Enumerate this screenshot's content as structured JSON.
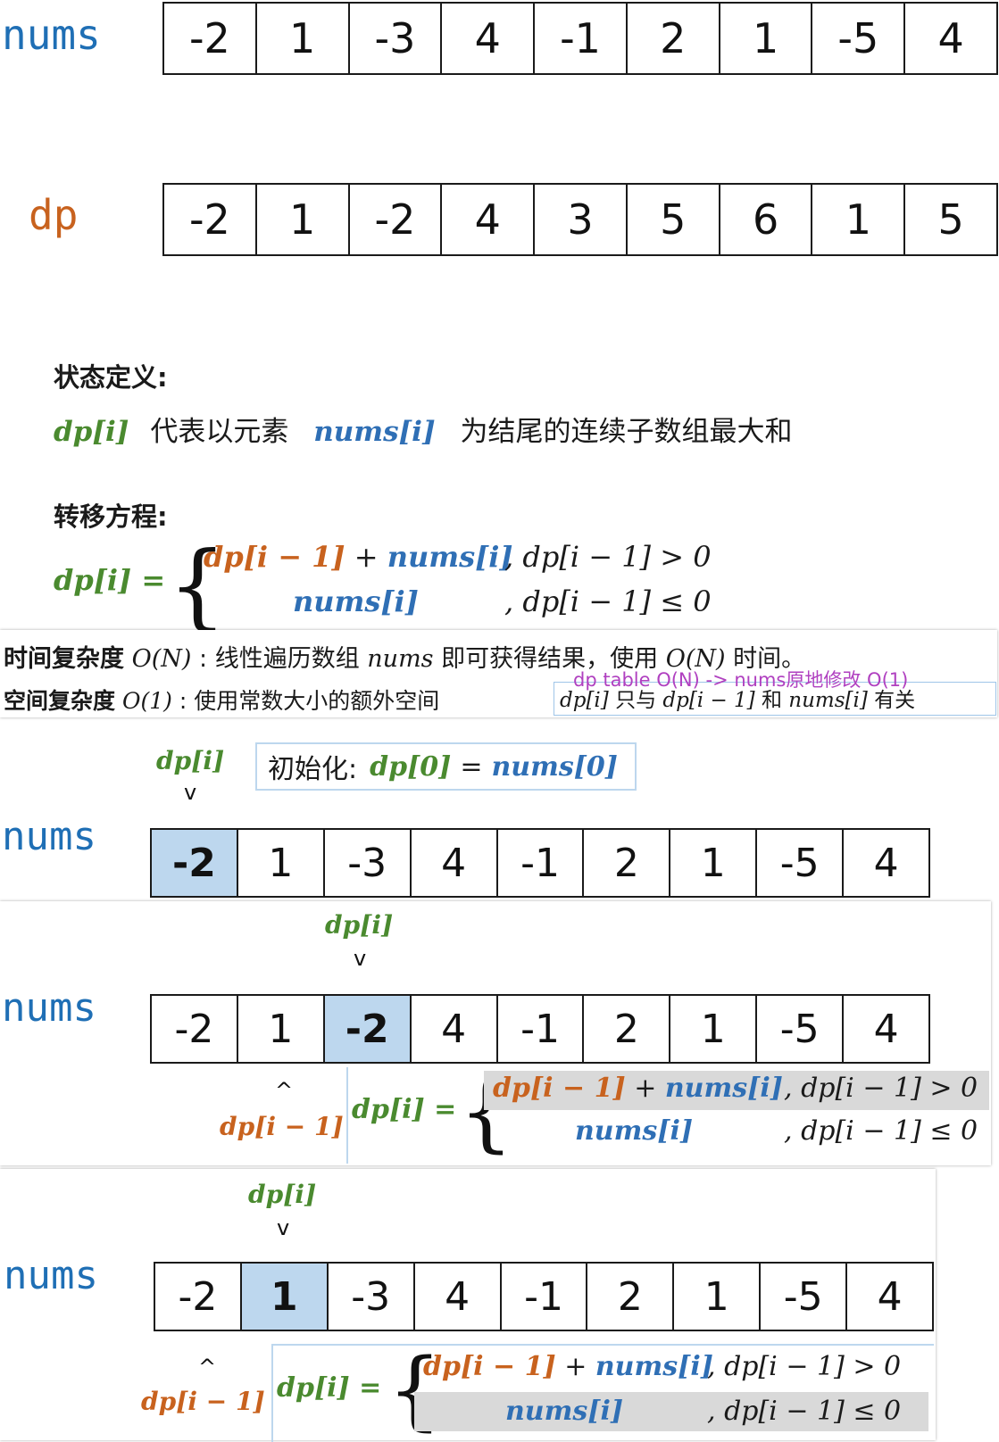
{
  "arrays": {
    "nums_label": "nums",
    "dp_label": "dp",
    "nums": [
      "-2",
      "1",
      "-3",
      "4",
      "-1",
      "2",
      "1",
      "-5",
      "4"
    ],
    "dp": [
      "-2",
      "1",
      "-2",
      "4",
      "3",
      "5",
      "6",
      "1",
      "5"
    ]
  },
  "definition": {
    "state_title": "状态定义:",
    "dp_i": "dp[i]",
    "text_represent": "代表以元素",
    "nums_i": "nums[i]",
    "text_rest": "为结尾的连续子数组最大和",
    "transfer_title": "转移方程:",
    "eq_lhs": "dp[i] =",
    "case1_expr_a": "dp[i − 1]",
    "plus": "+",
    "case1_expr_b": "nums[i]",
    "case1_cond": ", dp[i − 1] > 0",
    "case2_expr": "nums[i]",
    "case2_cond": ", dp[i − 1] ≤ 0"
  },
  "complexity": {
    "time_label": "时间复杂度",
    "time_on": "O(N)",
    "time_text_a": ": 线性遍历数组",
    "time_nums": "nums",
    "time_text_b": "即可获得结果，使用",
    "time_on2": "O(N)",
    "time_text_c": "时间。",
    "space_label": "空间复杂度",
    "space_o1": "O(1)",
    "space_text_a": ": 使用常数大小的额外空间",
    "space_dp_i": "dp[i]",
    "space_text_b": "只与",
    "space_dp_prev": "dp[i − 1]",
    "space_text_c": "和",
    "space_nums_i": "nums[i]",
    "space_text_d": "有关",
    "annotation": "dp table O(N) -> nums原地修改 O(1)"
  },
  "step1": {
    "pointer": "dp[i]",
    "caret": "v",
    "init_label": "初始化:",
    "init_expr_a": "dp[0]",
    "init_eq": "=",
    "init_expr_b": "nums[0]",
    "nums_label": "nums",
    "values": [
      "-2",
      "1",
      "-3",
      "4",
      "-1",
      "2",
      "1",
      "-5",
      "4"
    ],
    "highlight_index": 0
  },
  "step2": {
    "pointer": "dp[i]",
    "caret_down": "v",
    "caret_up": "^",
    "prev_label": "dp[i − 1]",
    "nums_label": "nums",
    "values": [
      "-2",
      "1",
      "-2",
      "4",
      "-1",
      "2",
      "1",
      "-5",
      "4"
    ],
    "highlight_index": 2,
    "eq_lhs": "dp[i] =",
    "case1_a": "dp[i − 1]",
    "plus": "+",
    "case1_b": "nums[i]",
    "case1_cond": ", dp[i − 1] > 0",
    "case2": "nums[i]",
    "case2_cond": ", dp[i − 1] ≤ 0"
  },
  "step3": {
    "pointer": "dp[i]",
    "caret_down": "v",
    "caret_up": "^",
    "prev_label": "dp[i − 1]",
    "nums_label": "nums",
    "values": [
      "-2",
      "1",
      "-3",
      "4",
      "-1",
      "2",
      "1",
      "-5",
      "4"
    ],
    "highlight_index": 1,
    "eq_lhs": "dp[i] =",
    "case1_a": "dp[i − 1]",
    "plus": "+",
    "case1_b": "nums[i]",
    "case1_cond": ", dp[i − 1] > 0",
    "case2": "nums[i]",
    "case2_cond": ", dp[i − 1] ≤ 0"
  }
}
